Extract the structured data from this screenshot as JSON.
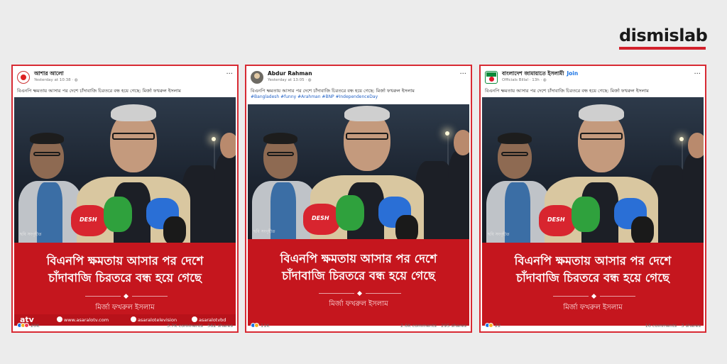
{
  "brand": {
    "name": "dismislab",
    "accent": "#d2202b"
  },
  "posts": [
    {
      "author": "আশার আলো",
      "meta": "Yesterday at 10:38 · ",
      "caption": "বিএনপি ক্ষমতায় আসার পর দেশে চাঁদাবাজি চিরতরে বন্ধ হয়ে গেছে: মির্জা ফখরুল ইসলাম",
      "more": "···",
      "credit": "ছবি সংগৃহীত",
      "mic_label": "DESH",
      "headline_1": "বিএনপি ক্ষমতায় আসার পর দেশে",
      "headline_2": "চাঁদাবাজি চিরতরে বন্ধ হয়ে গেছে",
      "speaker": "মির্জা ফখরুল ইসলাম",
      "footer": {
        "logo": "atv",
        "website": "www.asaralotv.com",
        "facebook": "asaralotelevision",
        "youtube": "asaralotvbd"
      },
      "reactions": "20K",
      "comments": "3.7K comments",
      "shares": "562 shares"
    },
    {
      "author": "Abdur Rahman",
      "meta": "Yesterday at 13:05 · ",
      "caption": "বিএনপি ক্ষমতায় আসার পর দেশে চাঁদাবাজি চিরতরে বন্ধ হয়ে গেছে: মির্জা ফখরুল ইসলাম",
      "hashtags": "#Bangladesh #funny #Arahman #BNP #IndependenceDay",
      "more": "···",
      "credit": "ছবি সংগৃহীত",
      "mic_label": "DESH",
      "headline_1": "বিএনপি ক্ষমতায় আসার পর দেশে",
      "headline_2": "চাঁদাবাজি চিরতরে বন্ধ হয়ে গেছে",
      "speaker": "মির্জা ফখরুল ইসলাম",
      "reactions": "11K",
      "comments": "2.6K comments",
      "shares": "295 shares"
    },
    {
      "author": "বাংলাদেশ জামায়াতে ইসলামী",
      "join": "Join",
      "meta": "Officials Billal · 13h · ",
      "caption": "বিএনপি ক্ষমতায় আসার পর দেশে চাঁদাবাজি চিরতরে বন্ধ হয়ে গেছে: মির্জা ফখরুল ইসলাম",
      "more": "···",
      "credit": "ছবি সংগৃহীত",
      "mic_label": "DESH",
      "headline_1": "বিএনপি ক্ষমতায় আসার পর দেশে",
      "headline_2": "চাঁদাবাজি চিরতরে বন্ধ হয়ে গেছে",
      "speaker": "মির্জা ফখরুল ইসলাম",
      "reactions": "22",
      "comments": "16 comments",
      "shares": "3 shares"
    }
  ],
  "colors": {
    "post_border": "#d82a33",
    "panel": "#c5161e",
    "link": "#1b74e4"
  }
}
